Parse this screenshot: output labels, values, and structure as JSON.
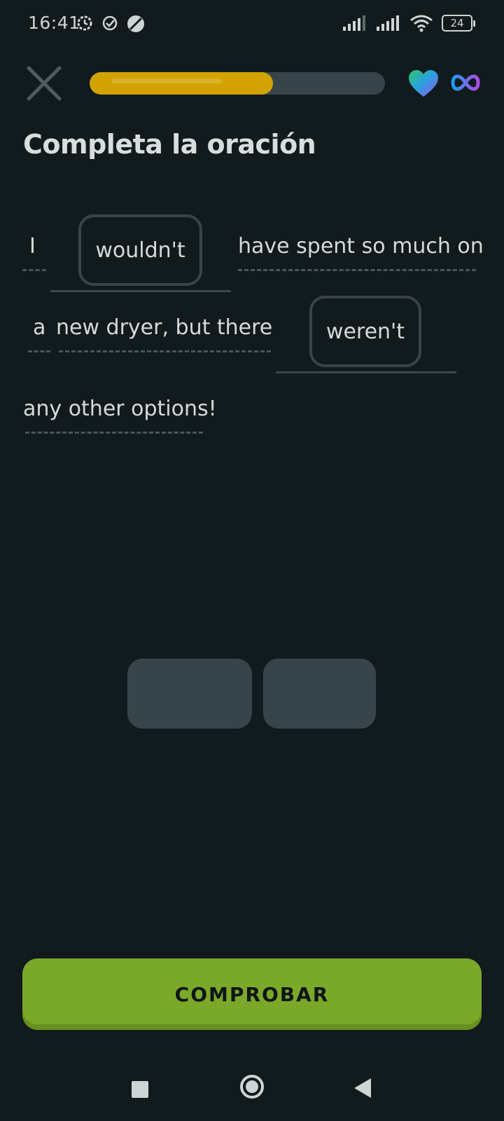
{
  "status_bar": {
    "time": "16:41",
    "battery": "24"
  },
  "header": {
    "progress": 0.62,
    "icons": [
      "close-icon",
      "heart-icon",
      "infinity-icon"
    ]
  },
  "title": "Completa la oración",
  "sentence": {
    "line1_word1": "I",
    "blank1_value": "wouldn't",
    "line1_rest": "have spent so much on",
    "line2_word1": "a",
    "line2_rest": "new dryer, but there",
    "blank2_value": "weren't",
    "line3": "any other options!"
  },
  "check_button": {
    "label": "COMPROBAR"
  },
  "colors": {
    "background": "#111a1d",
    "progress_fill": "#d2a300",
    "check_button": "#7aa929",
    "chip_border": "#37454a"
  }
}
